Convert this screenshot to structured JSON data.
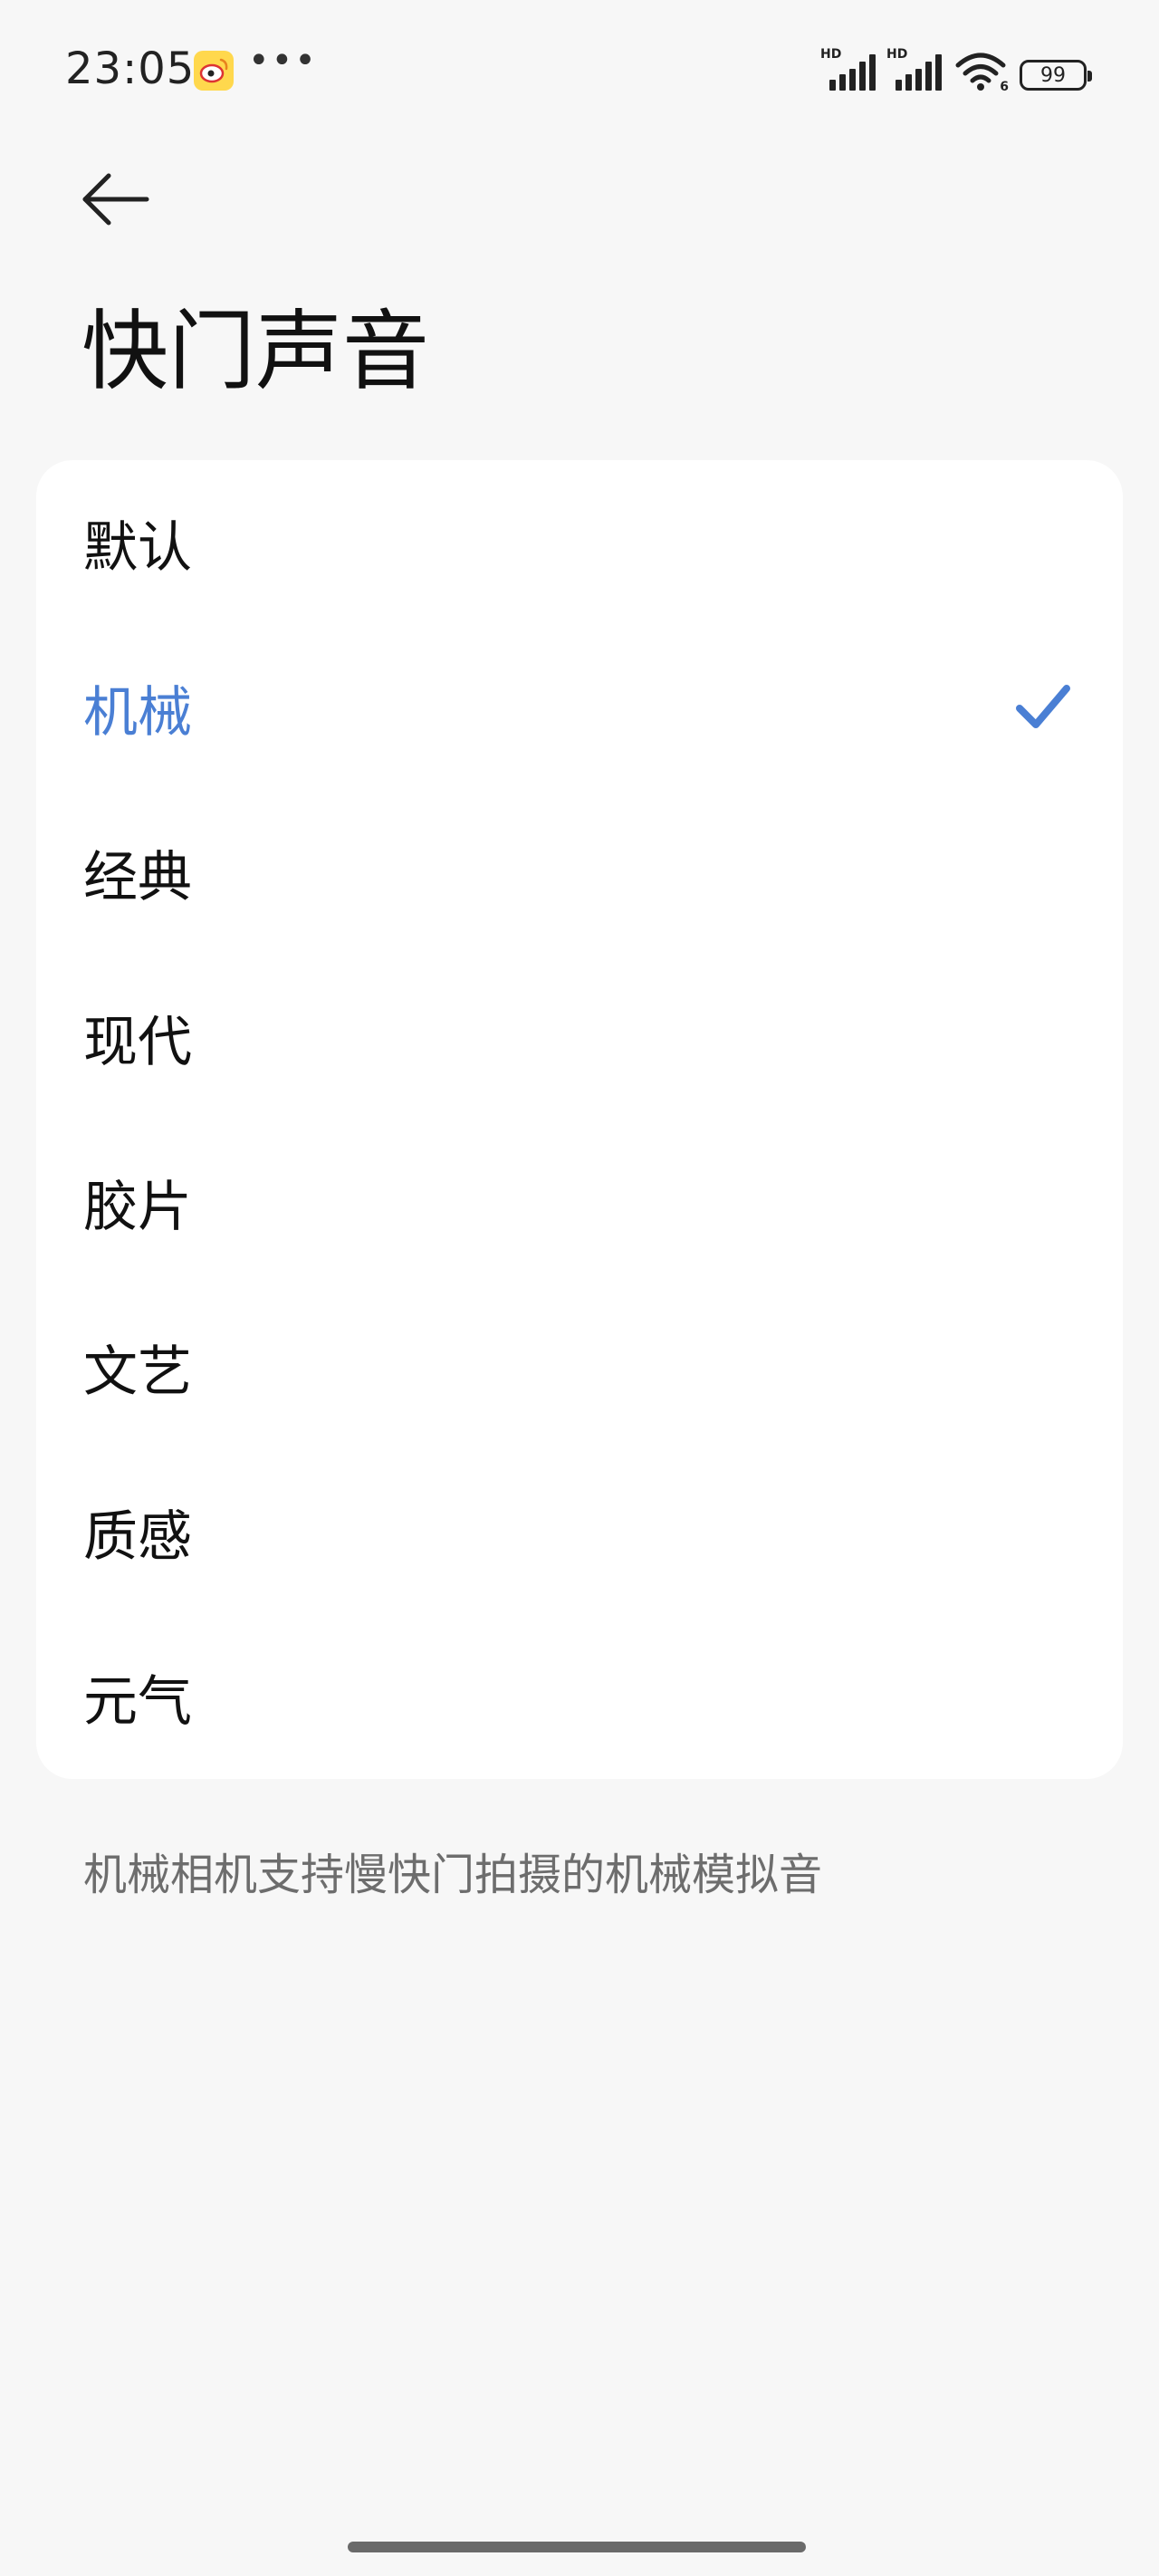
{
  "status_bar": {
    "time": "23:05",
    "more": "•••",
    "signal_badge": "HD",
    "wifi_badge": "6",
    "battery": "99"
  },
  "header": {
    "title": "快门声音"
  },
  "options": [
    {
      "label": "默认",
      "selected": false
    },
    {
      "label": "机械",
      "selected": true
    },
    {
      "label": "经典",
      "selected": false
    },
    {
      "label": "现代",
      "selected": false
    },
    {
      "label": "胶片",
      "selected": false
    },
    {
      "label": "文艺",
      "selected": false
    },
    {
      "label": "质感",
      "selected": false
    },
    {
      "label": "元气",
      "selected": false
    }
  ],
  "footnote": "机械相机支持慢快门拍摄的机械模拟音",
  "colors": {
    "accent": "#4a7fd4",
    "background": "#f7f7f7",
    "card": "#ffffff",
    "secondary_text": "#6d6d6d"
  }
}
